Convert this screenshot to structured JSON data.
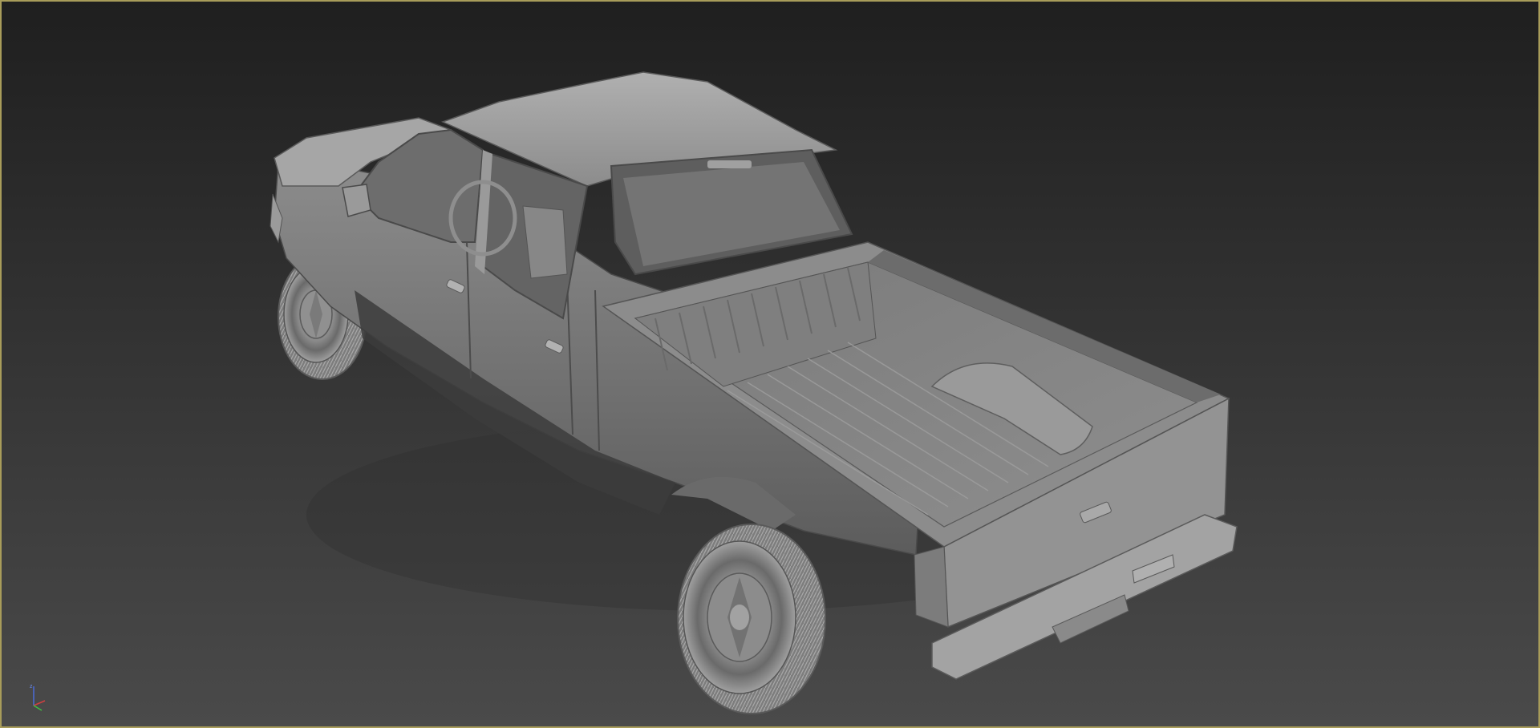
{
  "app": {
    "viewport_mode": "perspective-shaded",
    "active_viewport": true
  },
  "viewport": {
    "background_top": "#1f1f1f",
    "background_bottom": "#4a4a4a",
    "active_border_color": "#a89c5a"
  },
  "scene": {
    "object": "pickup-truck-model",
    "material": "default-gray-clay",
    "model_color": "#8a8a8a"
  },
  "axis_gizmo": {
    "x_color": "#d04040",
    "y_color": "#40c040",
    "z_color": "#4a6ad8",
    "z_label": "z"
  }
}
